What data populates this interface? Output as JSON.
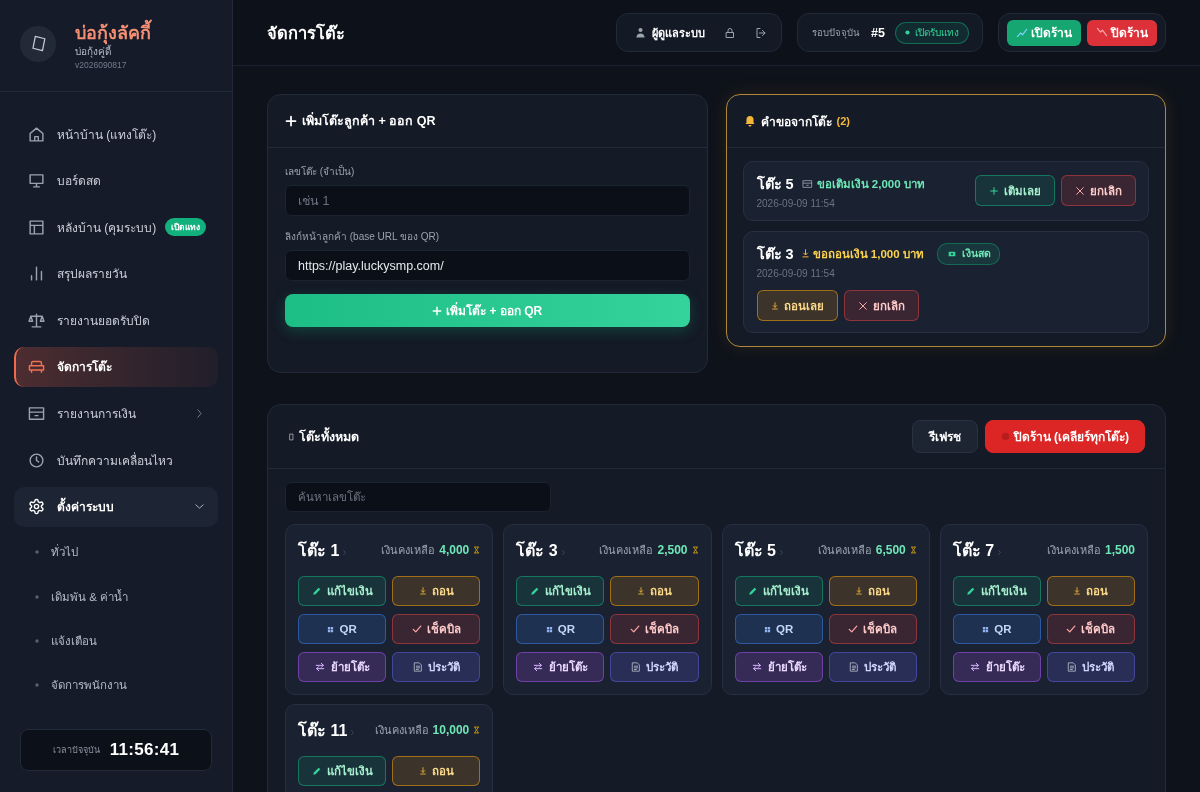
{
  "sidebar": {
    "brand": {
      "title": "บ่อกุ้งลัคกี้",
      "subtitle": "บ่อกุ้งคู่ดี้",
      "version": "v2026090817"
    },
    "nav": [
      {
        "label": "หน้าบ้าน (แทงโต๊ะ)",
        "selected": false
      },
      {
        "label": "บอร์ดสด",
        "selected": false
      },
      {
        "label": "หลังบ้าน (คุมระบบ)",
        "selected": false,
        "badge": "เปิดแทง"
      },
      {
        "label": "สรุปผลรายวัน",
        "selected": false
      },
      {
        "label": "รายงานยอดรับปิด",
        "selected": false
      },
      {
        "label": "จัดการโต๊ะ",
        "selected": true
      },
      {
        "label": "รายงานการเงิน",
        "selected": false,
        "expanded": false
      },
      {
        "label": "บันทึกความเคลื่อนไหว",
        "selected": false
      },
      {
        "label": "ตั้งค่าระบบ",
        "selected": false,
        "expanded": true,
        "children": [
          {
            "label": "ทั่วไป",
            "selected": false
          },
          {
            "label": "เดิมพัน & ค่าน้ำ",
            "selected": false
          },
          {
            "label": "แจ้งเตือน",
            "selected": false
          },
          {
            "label": "จัดการพนักงาน",
            "selected": false
          }
        ]
      }
    ],
    "clock": {
      "label": "เวลาปัจจุบัน",
      "time": "11:56:41"
    }
  },
  "header": {
    "title": "จัดการโต๊ะ",
    "user": "ผู้ดูแลระบบ",
    "round": {
      "label": "รอบปัจจุบัน",
      "number": "#5",
      "status": "เปิดรับแทง"
    },
    "shop_buttons": [
      {
        "label": "เปิดร้าน",
        "kind": "open"
      },
      {
        "label": "ปิดร้าน",
        "kind": "close"
      }
    ]
  },
  "add_table": {
    "title": "เพิ่มโต๊ะลูกค้า + ออก QR",
    "fields": [
      {
        "label": "เลขโต๊ะ (จำเป็น)",
        "placeholder": "เช่น 1"
      },
      {
        "label": "ลิงก์หน้าลูกค้า (base URL ของ QR)",
        "value": "https://play.luckysmp.com/"
      }
    ],
    "submit": "เพิ่มโต๊ะ + ออก QR"
  },
  "requests": {
    "title": "คำขอจากโต๊ะ",
    "count": "(2)",
    "items": [
      {
        "table": "โต๊ะ 5",
        "kind": "deposit",
        "text": "ขอเติมเงิน 2,000 บาท",
        "time": "2026-09-09 11:54",
        "actions": [
          {
            "label": "เติมเลย",
            "kind": "deposit"
          },
          {
            "label": "ยกเลิก",
            "kind": "cancel"
          }
        ]
      },
      {
        "table": "โต๊ะ 3",
        "kind": "withdraw",
        "text": "ขอถอนเงิน 1,000 บาท",
        "tag": "เงินสด",
        "time": "2026-09-09 11:54",
        "actions": [
          {
            "label": "ถอนเลย",
            "kind": "withdraw"
          },
          {
            "label": "ยกเลิก",
            "kind": "cancel"
          }
        ]
      }
    ]
  },
  "tables": {
    "title": "โต๊ะทั้งหมด",
    "buttons": [
      {
        "label": "รีเฟรช",
        "kind": "refresh"
      },
      {
        "label": "ปิดร้าน (เคลียร์ทุกโต๊ะ)",
        "kind": "close_all"
      }
    ],
    "search": {
      "placeholder": "ค้นหาเลขโต๊ะ"
    },
    "items": [
      {
        "name": "โต๊ะ 1",
        "balance_label": "เงินคงเหลือ",
        "balance": "4,000",
        "pending": true,
        "actions": [
          {
            "label": "แก้ไขเงิน",
            "kind": "edit"
          },
          {
            "label": "ถอน",
            "kind": "withdraw"
          },
          {
            "label": "QR",
            "kind": "qr"
          },
          {
            "label": "เช็คบิล",
            "kind": "checkout"
          },
          {
            "label": "ย้ายโต๊ะ",
            "kind": "move"
          },
          {
            "label": "ประวัติ",
            "kind": "history"
          }
        ]
      },
      {
        "name": "โต๊ะ 3",
        "balance_label": "เงินคงเหลือ",
        "balance": "2,500",
        "pending": true,
        "actions": [
          {
            "label": "แก้ไขเงิน",
            "kind": "edit"
          },
          {
            "label": "ถอน",
            "kind": "withdraw"
          },
          {
            "label": "QR",
            "kind": "qr"
          },
          {
            "label": "เช็คบิล",
            "kind": "checkout"
          },
          {
            "label": "ย้ายโต๊ะ",
            "kind": "move"
          },
          {
            "label": "ประวัติ",
            "kind": "history"
          }
        ]
      },
      {
        "name": "โต๊ะ 5",
        "balance_label": "เงินคงเหลือ",
        "balance": "6,500",
        "pending": true,
        "actions": [
          {
            "label": "แก้ไขเงิน",
            "kind": "edit"
          },
          {
            "label": "ถอน",
            "kind": "withdraw"
          },
          {
            "label": "QR",
            "kind": "qr"
          },
          {
            "label": "เช็คบิล",
            "kind": "checkout"
          },
          {
            "label": "ย้ายโต๊ะ",
            "kind": "move"
          },
          {
            "label": "ประวัติ",
            "kind": "history"
          }
        ]
      },
      {
        "name": "โต๊ะ 7",
        "balance_label": "เงินคงเหลือ",
        "balance": "1,500",
        "pending": false,
        "actions": [
          {
            "label": "แก้ไขเงิน",
            "kind": "edit"
          },
          {
            "label": "ถอน",
            "kind": "withdraw"
          },
          {
            "label": "QR",
            "kind": "qr"
          },
          {
            "label": "เช็คบิล",
            "kind": "checkout"
          },
          {
            "label": "ย้ายโต๊ะ",
            "kind": "move"
          },
          {
            "label": "ประวัติ",
            "kind": "history"
          }
        ]
      },
      {
        "name": "โต๊ะ 11",
        "balance_label": "เงินคงเหลือ",
        "balance": "10,000",
        "pending": true,
        "actions": [
          {
            "label": "แก้ไขเงิน",
            "kind": "edit"
          },
          {
            "label": "ถอน",
            "kind": "withdraw"
          }
        ]
      }
    ]
  }
}
